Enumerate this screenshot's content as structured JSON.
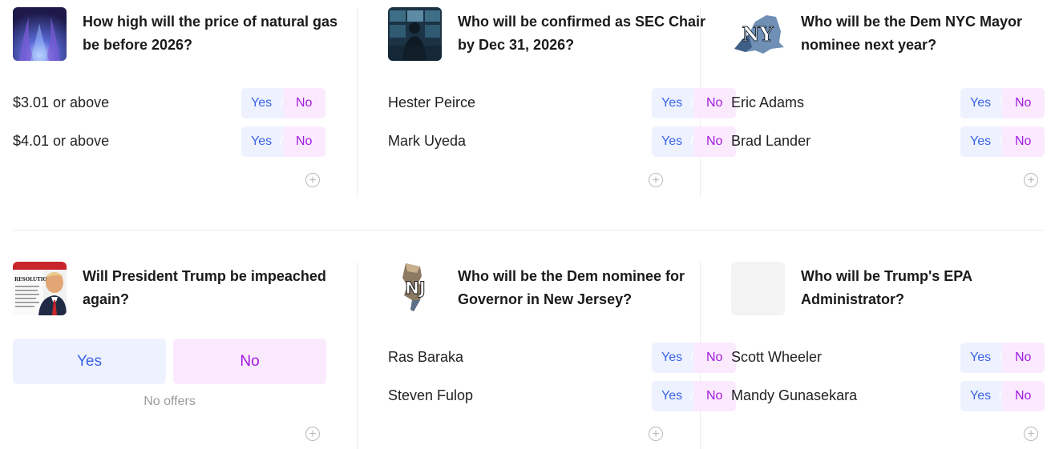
{
  "markets": [
    {
      "title": "How high will the price of natural gas be before 2026?",
      "thumb_icon": "gas-flame-image",
      "outcomes": [
        {
          "label": "$3.01 or above",
          "yes": "Yes",
          "no": "No"
        },
        {
          "label": "$4.01 or above",
          "yes": "Yes",
          "no": "No"
        }
      ]
    },
    {
      "title": "Who will be confirmed as SEC Chair by Dec 31, 2026?",
      "thumb_icon": "trading-screens-image",
      "outcomes": [
        {
          "label": "Hester Peirce",
          "yes": "Yes",
          "no": "No"
        },
        {
          "label": "Mark Uyeda",
          "yes": "Yes",
          "no": "No"
        }
      ]
    },
    {
      "title": "Who will be the Dem NYC Mayor nominee next year?",
      "thumb_icon": "new-york-map-image",
      "thumb_text": "NY",
      "outcomes": [
        {
          "label": "Eric Adams",
          "yes": "Yes",
          "no": "No"
        },
        {
          "label": "Brad Lander",
          "yes": "Yes",
          "no": "No"
        }
      ]
    },
    {
      "title": "Will President Trump be impeached again?",
      "thumb_icon": "trump-resolution-image",
      "thumb_text": "RESOLUTION",
      "yes": "Yes",
      "no": "No",
      "status": "No offers"
    },
    {
      "title": "Who will be the Dem nominee for Governor in New Jersey?",
      "thumb_icon": "new-jersey-map-image",
      "thumb_text": "NJ",
      "outcomes": [
        {
          "label": "Ras Baraka",
          "yes": "Yes",
          "no": "No"
        },
        {
          "label": "Steven Fulop",
          "yes": "Yes",
          "no": "No"
        }
      ]
    },
    {
      "title": "Who will be Trump's EPA Administrator?",
      "thumb_icon": "blank-placeholder-image",
      "outcomes": [
        {
          "label": "Scott Wheeler",
          "yes": "Yes",
          "no": "No"
        },
        {
          "label": "Mandy Gunasekara",
          "yes": "Yes",
          "no": "No"
        }
      ]
    }
  ],
  "colors": {
    "yes": "#3b63e6",
    "no": "#a21be0",
    "yes_bg": "#eef2ff",
    "no_bg": "#fbeafe"
  }
}
